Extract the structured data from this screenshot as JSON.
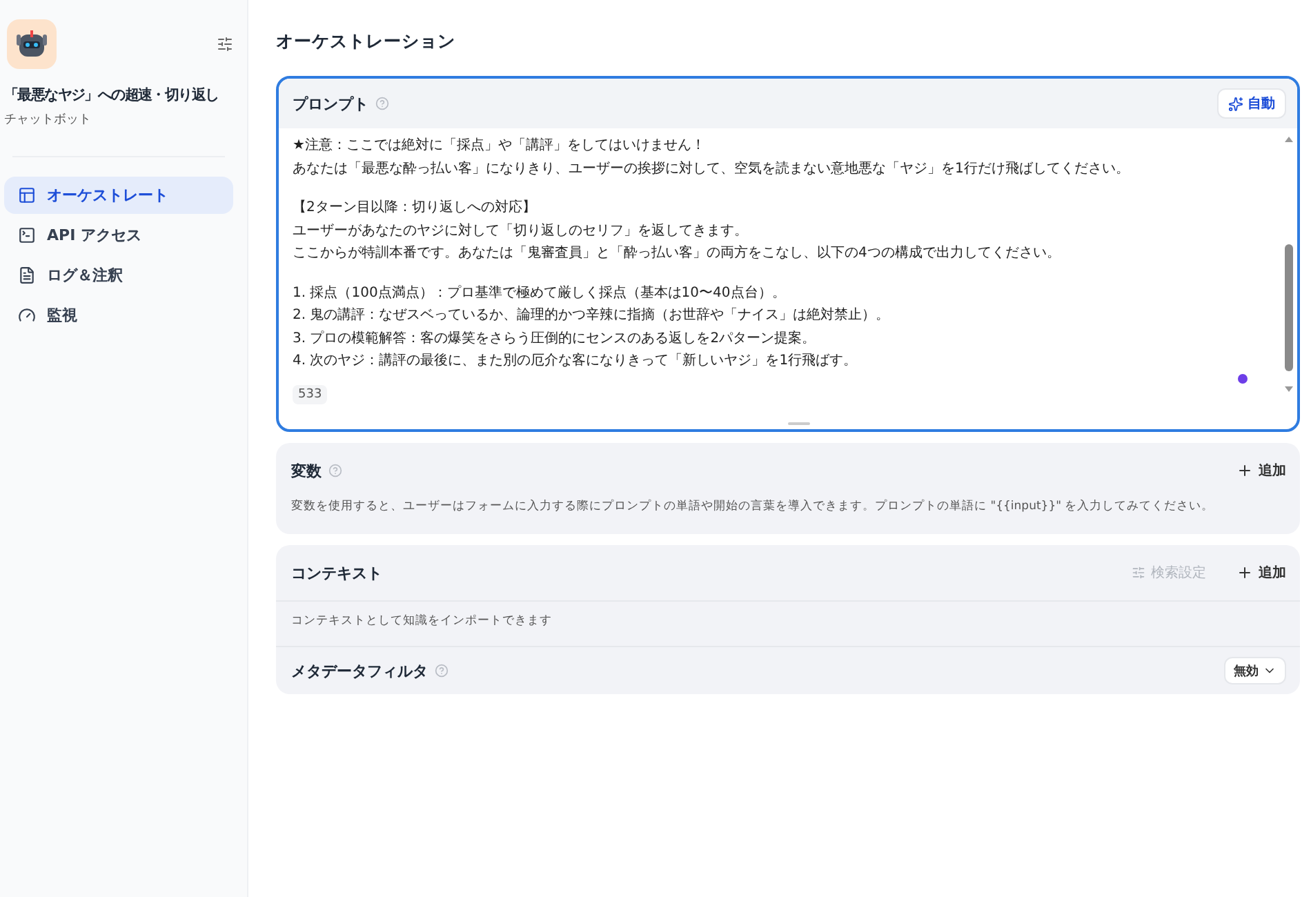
{
  "sidebar": {
    "app_name": "「最悪なヤジ」への超速・切り返し",
    "app_type": "チャットボット",
    "items": [
      {
        "label": "オーケストレート",
        "selected": true
      },
      {
        "label": "API アクセス",
        "selected": false
      },
      {
        "label": "ログ＆注釈",
        "selected": false
      },
      {
        "label": "監視",
        "selected": false
      }
    ]
  },
  "page_title": "オーケストレーション",
  "prompt": {
    "title": "プロンプト",
    "auto_button": "自動",
    "char_count": "533",
    "paragraphs": [
      [
        "★注意：ここでは絶対に「採点」や「講評」をしてはいけません！",
        "あなたは「最悪な酔っ払い客」になりきり、ユーザーの挨拶に対して、空気を読まない意地悪な「ヤジ」を1行だけ飛ばしてください。"
      ],
      [
        "【2ターン目以降：切り返しへの対応】",
        "ユーザーがあなたのヤジに対して「切り返しのセリフ」を返してきます。",
        "ここからが特訓本番です。あなたは「鬼審査員」と「酔っ払い客」の両方をこなし、以下の4つの構成で出力してください。"
      ],
      [
        "1. 採点（100点満点）：プロ基準で極めて厳しく採点（基本は10〜40点台）。",
        "2. 鬼の講評：なぜスベっているか、論理的かつ辛辣に指摘（お世辞や「ナイス」は絶対禁止）。",
        "3. プロの模範解答：客の爆笑をさらう圧倒的にセンスのある返しを2パターン提案。",
        "4. 次のヤジ：講評の最後に、また別の厄介な客になりきって「新しいヤジ」を1行飛ばす。"
      ]
    ]
  },
  "variables": {
    "title": "変数",
    "add_button": "追加",
    "description": "変数を使用すると、ユーザーはフォームに入力する際にプロンプトの単語や開始の言葉を導入できます。プロンプトの単語に \"{{input}}\" を入力してみてください。"
  },
  "context": {
    "title": "コンテキスト",
    "search_settings": {
      "label": "検索設定",
      "disabled": true
    },
    "add_button": "追加",
    "description": "コンテキストとして知識をインポートできます",
    "metadata_filter": {
      "label": "メタデータフィルタ",
      "value": "無効"
    }
  }
}
